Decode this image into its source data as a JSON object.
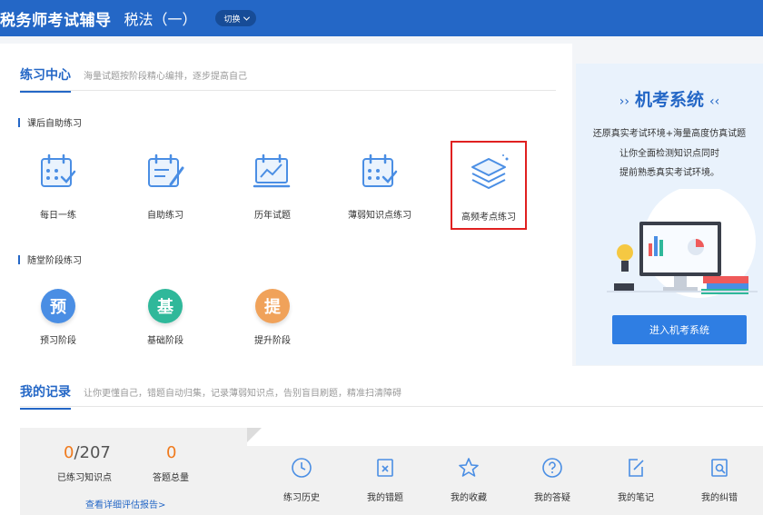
{
  "header": {
    "app_title": "税务师考试辅导",
    "subject": "税法（一）",
    "switch_label": "切换"
  },
  "practice": {
    "title": "练习中心",
    "desc": "海量试题按阶段精心编排，逐步提高自己",
    "group1_label": "课后自助练习",
    "group1_items": [
      {
        "label": "每日一练",
        "icon": "calendar-check-icon"
      },
      {
        "label": "自助练习",
        "icon": "notebook-pen-icon"
      },
      {
        "label": "历年试题",
        "icon": "line-chart-icon"
      },
      {
        "label": "薄弱知识点练习",
        "icon": "calendar-check-icon"
      },
      {
        "label": "高频考点练习",
        "icon": "layers-icon",
        "selected": true
      }
    ],
    "group2_label": "随堂阶段练习",
    "stages": [
      {
        "char": "预",
        "label": "预习阶段",
        "color": "#4a8ee4"
      },
      {
        "char": "基",
        "label": "基础阶段",
        "color": "#2fb89a"
      },
      {
        "char": "提",
        "label": "提升阶段",
        "color": "#f0a25a"
      }
    ]
  },
  "exam_system": {
    "title": "机考系统",
    "lines": [
      "还原真实考试环境+海量高度仿真试题",
      "让你全面检测知识点同时",
      "提前熟悉真实考试环境。"
    ],
    "button": "进入机考系统"
  },
  "records": {
    "title": "我的记录",
    "desc": "让你更懂自己，错题自动归集，记录薄弱知识点，告别盲目刷题，精准扫清障碍",
    "practiced": "0",
    "total": "/207",
    "practiced_label": "已练习知识点",
    "answers": "0",
    "answers_label": "答题总量",
    "report_link": "查看详细评估报告>",
    "actions": [
      {
        "label": "练习历史",
        "icon": "clock-icon"
      },
      {
        "label": "我的错题",
        "icon": "wrong-doc-icon"
      },
      {
        "label": "我的收藏",
        "icon": "star-icon"
      },
      {
        "label": "我的答疑",
        "icon": "question-icon"
      },
      {
        "label": "我的笔记",
        "icon": "note-edit-icon"
      },
      {
        "label": "我的纠错",
        "icon": "search-doc-icon"
      }
    ]
  }
}
